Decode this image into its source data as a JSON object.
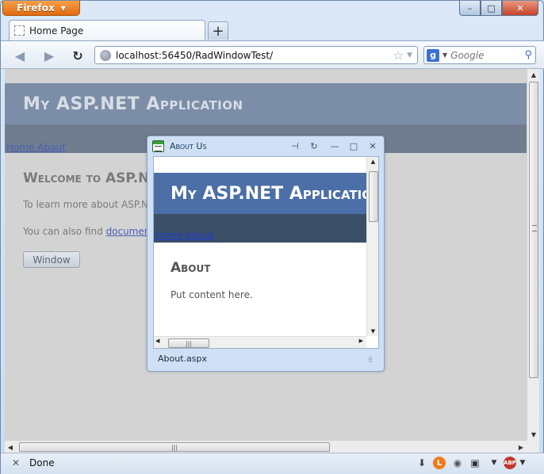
{
  "browser": {
    "menu_label": "Firefox",
    "window_controls": {
      "minimize": "–",
      "maximize": "□",
      "close": "✕"
    },
    "tabs": [
      {
        "label": "Home Page"
      }
    ],
    "new_tab_label": "+",
    "url": "localhost:56450/RadWindowTest/",
    "search": {
      "engine_letter": "g",
      "placeholder": "Google"
    },
    "status_text": "Done"
  },
  "page": {
    "site_title": "My ASP.NET Application",
    "menu_links": "Home About",
    "welcome_heading": "Welcome to ASP.NET!",
    "para1": "To learn more about ASP.NET visit www.asp.net.",
    "para2_prefix": "You can also find ",
    "para2_link": "documentation on ASP.NET at MSDN.",
    "window_button": "Window"
  },
  "radwindow": {
    "title": "About Us",
    "inner_site_title": "My ASP.NET Application",
    "inner_menu_links": "Home About",
    "heading": "About",
    "text": "Put content here.",
    "status": "About.aspx"
  },
  "icons": {
    "back": "back-arrow-icon",
    "forward": "forward-arrow-icon",
    "reload": "reload-icon",
    "bookmark": "star-icon",
    "search": "magnifier-icon",
    "download": "download-icon",
    "adblock": "adblock-icon"
  },
  "colors": {
    "accent": "#e06a10",
    "site_header": "#7c8ea7",
    "modal_header": "#4b6fa6"
  }
}
